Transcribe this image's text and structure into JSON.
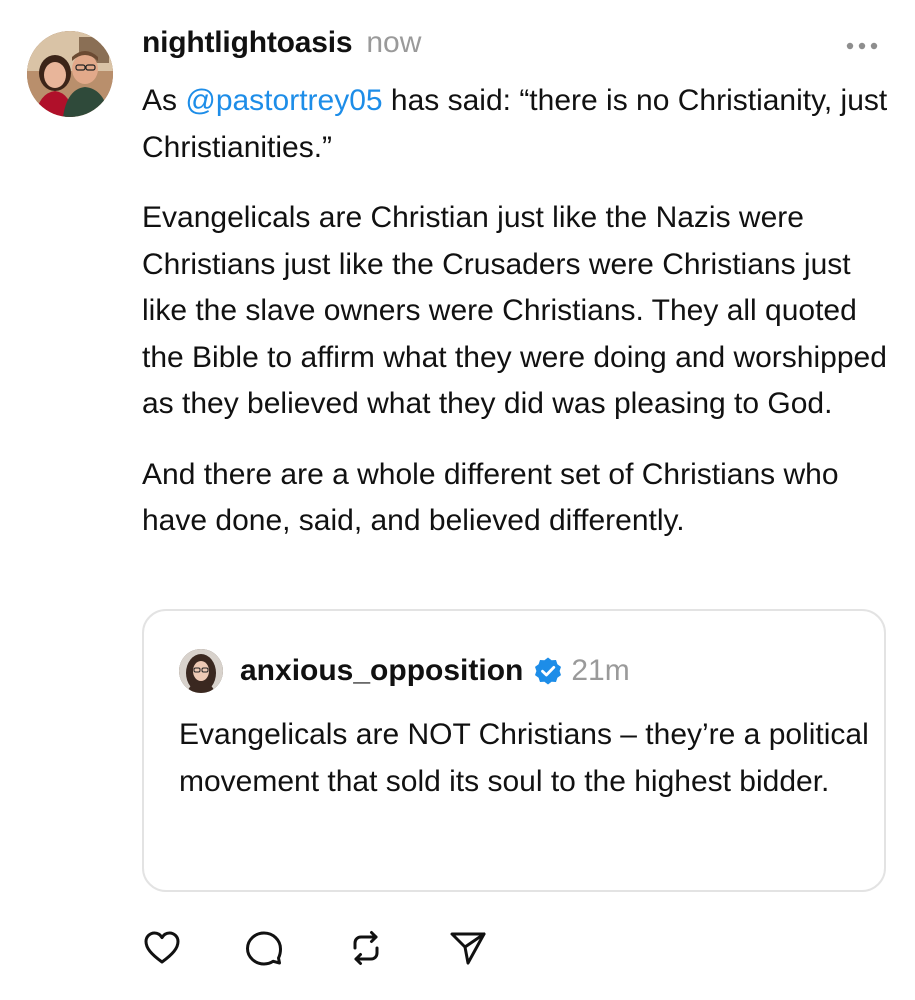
{
  "post": {
    "username": "nightlightoasis",
    "time": "now",
    "mention": "@pastortrey05",
    "p1_before": "As ",
    "p1_after": " has said: “there is no Christianity, just Christianities.”",
    "p2": "Evangelicals are Christian just like the Nazis were Christians just like the Crusaders were Christians just like the slave owners were Christians. They all quoted the Bible to affirm what they were doing and worshipped as they believed what they did was pleasing to God.",
    "p3": "And there are a whole different set of Christians who have done, said, and believed differently."
  },
  "quote": {
    "username": "anxious_opposition",
    "verified": true,
    "time": "21m",
    "text": "Evangelicals are NOT Christians – they’re a political movement that sold its soul to the highest bidder."
  },
  "icons": {
    "more": "more-horizontal-icon",
    "like": "heart-icon",
    "reply": "comment-bubble-icon",
    "repost": "repost-icon",
    "share": "send-icon",
    "verified": "verified-badge-icon"
  },
  "colors": {
    "mention": "#1d8de8",
    "verified": "#1d8de8",
    "muted": "#9a9a9a",
    "border": "#e3e3e3"
  }
}
